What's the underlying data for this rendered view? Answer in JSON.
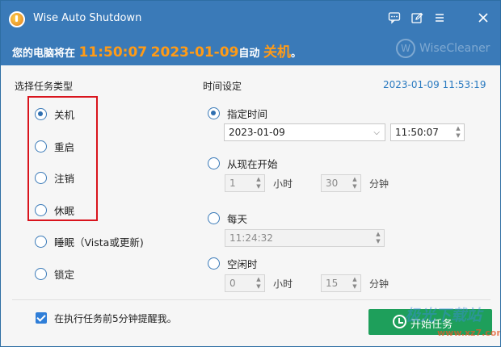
{
  "window": {
    "title": "Wise Auto Shutdown",
    "titlebar_icons": [
      "feedback-icon",
      "edit-icon",
      "menu-icon",
      "close-icon"
    ]
  },
  "status": {
    "prefix": "您的电脑将在",
    "time": "11:50:07",
    "date": "2023-01-09",
    "middle": "自动",
    "action": "关机",
    "suffix": "。"
  },
  "brand": {
    "logo_letter": "W",
    "name": "WiseCleaner"
  },
  "task_type": {
    "label": "选择任务类型",
    "options": [
      {
        "label": "关机",
        "selected": true
      },
      {
        "label": "重启",
        "selected": false
      },
      {
        "label": "注销",
        "selected": false
      },
      {
        "label": "休眠",
        "selected": false
      },
      {
        "label": "睡眠（Vista或更新)",
        "selected": false
      },
      {
        "label": "锁定",
        "selected": false
      }
    ]
  },
  "time_settings": {
    "label": "时间设定",
    "current_datetime": "2023-01-09 11:53:19",
    "specified": {
      "label": "指定时间",
      "date_value": "2023-01-09",
      "time_value": "11:50:07",
      "selected": true
    },
    "from_now": {
      "label": "从现在开始",
      "hours": "1",
      "hours_unit": "小时",
      "minutes": "30",
      "minutes_unit": "分钟",
      "selected": false
    },
    "daily": {
      "label": "每天",
      "time_value": "11:24:32",
      "selected": false
    },
    "idle": {
      "label": "空闲时",
      "hours": "0",
      "hours_unit": "小时",
      "minutes": "15",
      "minutes_unit": "分钟",
      "selected": false
    }
  },
  "footer": {
    "reminder_label": "在执行任务前5分钟提醒我。",
    "reminder_checked": true,
    "start_button": "开始任务",
    "watermark_text": "极光下载站",
    "watermark_url": "www.xz7.com"
  },
  "colors": {
    "header": "#3a7ab8",
    "accent_orange": "#ff9b17",
    "start_button": "#1e9f5b",
    "highlight_box": "#d9141d"
  }
}
